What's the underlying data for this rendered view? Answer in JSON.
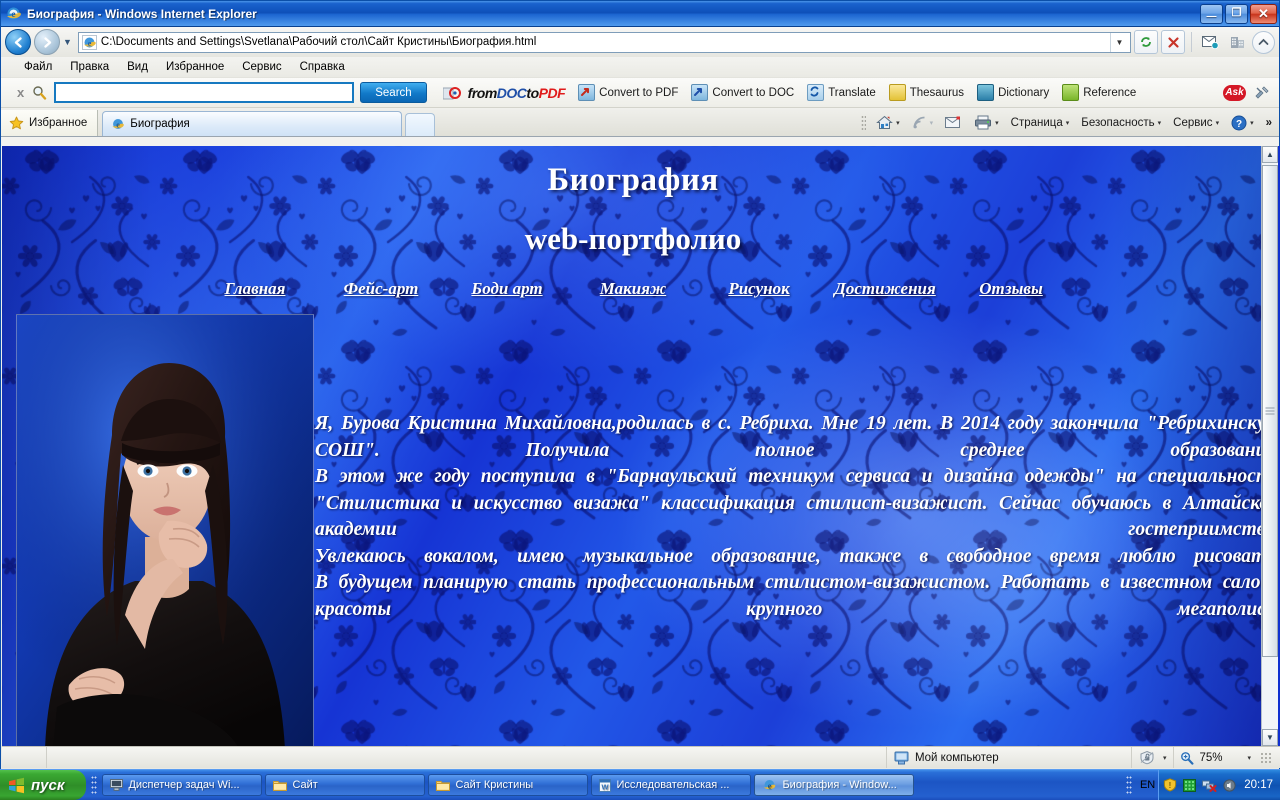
{
  "window": {
    "title": "Биография - Windows Internet Explorer",
    "minimize_label": "—",
    "maximize_label": "❐",
    "close_label": "✕"
  },
  "address_bar": {
    "url": "C:\\Documents and Settings\\Svetlana\\Рабочий стол\\Сайт Кристины\\Биография.html"
  },
  "menu": {
    "items": [
      {
        "label": "Файл"
      },
      {
        "label": "Правка"
      },
      {
        "label": "Вид"
      },
      {
        "label": "Избранное"
      },
      {
        "label": "Сервис"
      },
      {
        "label": "Справка"
      }
    ]
  },
  "ask_toolbar": {
    "close_label": "x",
    "search_value": "",
    "search_placeholder": "",
    "search_button": "Search",
    "logo": {
      "part1": "from",
      "part2": "DOC",
      "part3": "to",
      "part4": "PDF"
    },
    "items": [
      {
        "label": "Convert to PDF",
        "color": "#c2352a"
      },
      {
        "label": "Convert to DOC",
        "color": "#1f5fb8"
      },
      {
        "label": "Translate",
        "color": "#7fb8e6"
      },
      {
        "label": "Thesaurus",
        "color": "#e8c437"
      },
      {
        "label": "Dictionary",
        "color": "#2b7fa8"
      },
      {
        "label": "Reference",
        "color": "#7bb828"
      }
    ],
    "brand_badge": "Ask"
  },
  "tabs": {
    "favorites_label": "Избранное",
    "open_tabs": [
      {
        "label": "Биография",
        "active": true
      }
    ],
    "new_tab_label": ""
  },
  "command_bar": {
    "items": [
      {
        "label": "Страница",
        "caret": "▾"
      },
      {
        "label": "Безопасность",
        "caret": "▾"
      },
      {
        "label": "Сервис",
        "caret": "▾"
      }
    ],
    "overflow_label": "»"
  },
  "page": {
    "title": "Биография",
    "subtitle": "web-портфолио",
    "nav": [
      {
        "label": "Главная"
      },
      {
        "label": "Фейс-арт"
      },
      {
        "label": "Боди арт"
      },
      {
        "label": "Макияж"
      },
      {
        "label": "Рисунок"
      },
      {
        "label": "Достижения"
      },
      {
        "label": "Отзывы"
      }
    ],
    "photo_alt": "Портрет Кристины",
    "bio_paragraphs": [
      "Я, Бурова Кристина Михайловна,родилась в с. Ребриха. Мне 19 лет. В 2014 году закончила \"Ребрихинскую СОШ\". Получила полное среднее образование.",
      "В этом же году поступила в \"Барнаульский техникум сервиса и дизайна одежды\" на специальность \"Стилистика и искусство визажа\" классификация стилист-визажист. Сейчас обучаюсь в Алтайской академии гостеприимства.",
      "Увлекаюсь вокалом, имею музыкальное образование, также в свободное время люблю рисовать.",
      "В будущем планирую стать профессиональным стилистом-визажистом. Работать в известном салоне красоты крупного мегаполиса."
    ],
    "colors": {
      "background_blue": "#1634d4",
      "text_white": "#ffffff",
      "link_white": "#ffffff"
    }
  },
  "status_bar": {
    "zone": "Мой компьютер",
    "zoom": "75%",
    "zoom_caret": "▾",
    "zone_caret": "▾"
  },
  "taskbar": {
    "start_label": "пуск",
    "tasks": [
      {
        "label": "Диспетчер задач Wi...",
        "active": false,
        "icon": "monitor-icon"
      },
      {
        "label": "Сайт",
        "active": false,
        "icon": "folder-icon"
      },
      {
        "label": "Сайт Кристины",
        "active": false,
        "icon": "folder-icon"
      },
      {
        "label": "Исследовательская ...",
        "active": false,
        "icon": "word-icon"
      },
      {
        "label": "Биография - Window...",
        "active": true,
        "icon": "ie-icon"
      }
    ],
    "language": "EN",
    "clock": "20:17"
  }
}
